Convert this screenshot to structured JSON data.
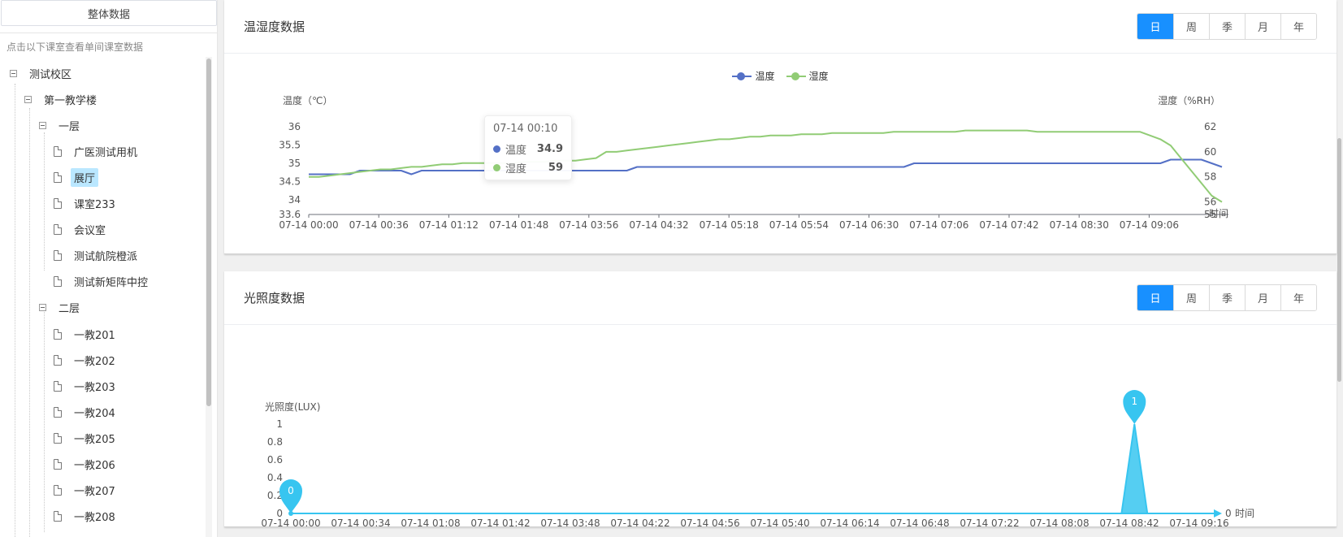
{
  "sidebar": {
    "overall_button": "整体数据",
    "hint": "点击以下课室查看单间课室数据",
    "tree": [
      {
        "label": "测试校区",
        "level": 0,
        "type": "folder"
      },
      {
        "label": "第一教学楼",
        "level": 1,
        "type": "folder"
      },
      {
        "label": "一层",
        "level": 2,
        "type": "folder"
      },
      {
        "label": "广医测试用机",
        "level": 3,
        "type": "leaf"
      },
      {
        "label": "展厅",
        "level": 3,
        "type": "leaf",
        "selected": true
      },
      {
        "label": "课室233",
        "level": 3,
        "type": "leaf"
      },
      {
        "label": "会议室",
        "level": 3,
        "type": "leaf"
      },
      {
        "label": "测试航院橙派",
        "level": 3,
        "type": "leaf"
      },
      {
        "label": "测试新矩阵中控",
        "level": 3,
        "type": "leaf"
      },
      {
        "label": "二层",
        "level": 2,
        "type": "folder"
      },
      {
        "label": "一教201",
        "level": 3,
        "type": "leaf"
      },
      {
        "label": "一教202",
        "level": 3,
        "type": "leaf"
      },
      {
        "label": "一教203",
        "level": 3,
        "type": "leaf"
      },
      {
        "label": "一教204",
        "level": 3,
        "type": "leaf"
      },
      {
        "label": "一教205",
        "level": 3,
        "type": "leaf"
      },
      {
        "label": "一教206",
        "level": 3,
        "type": "leaf"
      },
      {
        "label": "一教207",
        "level": 3,
        "type": "leaf"
      },
      {
        "label": "一教208",
        "level": 3,
        "type": "leaf"
      }
    ]
  },
  "temp_card": {
    "title": "温湿度数据",
    "periods": [
      "日",
      "周",
      "季",
      "月",
      "年"
    ],
    "active_period": "日"
  },
  "light_card": {
    "title": "光照度数据",
    "periods": [
      "日",
      "周",
      "季",
      "月",
      "年"
    ],
    "active_period": "日"
  },
  "tooltip": {
    "time": "07-14 00:10",
    "rows": [
      {
        "name": "温度",
        "value": "34.9",
        "color": "#5470c6"
      },
      {
        "name": "湿度",
        "value": "59",
        "color": "#91cc75"
      }
    ]
  },
  "chart_data": [
    {
      "type": "line",
      "legend": [
        "温度",
        "湿度"
      ],
      "legend_position": "top-center",
      "ylabel_left": "温度（℃）",
      "ylabel_right": "湿度（%RH）",
      "xlabel": "时间",
      "yticks_left": [
        "33.6",
        "34",
        "34.5",
        "35",
        "35.5",
        "36"
      ],
      "yticks_right": [
        "55",
        "56",
        "58",
        "60",
        "62"
      ],
      "ylim_left": [
        33.6,
        36
      ],
      "ylim_right": [
        55,
        62
      ],
      "xticks": [
        "07-14 00:00",
        "07-14 00:36",
        "07-14 01:12",
        "07-14 01:48",
        "07-14 03:56",
        "07-14 04:32",
        "07-14 05:18",
        "07-14 05:54",
        "07-14 06:30",
        "07-14 07:06",
        "07-14 07:42",
        "07-14 08:30",
        "07-14 09:06"
      ],
      "series": [
        {
          "name": "温度",
          "color": "#5470c6",
          "axis": "left",
          "values": [
            34.7,
            34.7,
            34.7,
            34.7,
            34.7,
            34.8,
            34.8,
            34.8,
            34.8,
            34.8,
            34.7,
            34.8,
            34.8,
            34.8,
            34.8,
            34.8,
            34.8,
            34.8,
            34.8,
            34.8,
            34.8,
            34.8,
            34.8,
            34.8,
            34.8,
            34.8,
            34.8,
            34.8,
            34.8,
            34.8,
            34.8,
            34.8,
            34.9,
            34.9,
            34.9,
            34.9,
            34.9,
            34.9,
            34.9,
            34.9,
            34.9,
            34.9,
            34.9,
            34.9,
            34.9,
            34.9,
            34.9,
            34.9,
            34.9,
            34.9,
            34.9,
            34.9,
            34.9,
            34.9,
            34.9,
            34.9,
            34.9,
            34.9,
            34.9,
            35.0,
            35.0,
            35.0,
            35.0,
            35.0,
            35.0,
            35.0,
            35.0,
            35.0,
            35.0,
            35.0,
            35.0,
            35.0,
            35.0,
            35.0,
            35.0,
            35.0,
            35.0,
            35.0,
            35.0,
            35.0,
            35.0,
            35.0,
            35.0,
            35.0,
            35.1,
            35.1,
            35.1,
            35.1,
            35.0,
            34.9
          ]
        },
        {
          "name": "湿度",
          "color": "#91cc75",
          "axis": "right",
          "values": [
            58.0,
            58.0,
            58.1,
            58.2,
            58.3,
            58.4,
            58.5,
            58.6,
            58.6,
            58.7,
            58.8,
            58.8,
            58.9,
            59.0,
            59.0,
            59.1,
            59.1,
            59.1,
            59.1,
            59.1,
            59.1,
            59.2,
            59.2,
            59.2,
            59.3,
            59.3,
            59.3,
            59.4,
            59.5,
            60.0,
            60.0,
            60.1,
            60.2,
            60.3,
            60.4,
            60.5,
            60.6,
            60.7,
            60.8,
            60.9,
            61.0,
            61.0,
            61.1,
            61.2,
            61.2,
            61.3,
            61.3,
            61.3,
            61.4,
            61.4,
            61.4,
            61.5,
            61.5,
            61.5,
            61.5,
            61.5,
            61.5,
            61.6,
            61.6,
            61.6,
            61.6,
            61.6,
            61.6,
            61.6,
            61.7,
            61.7,
            61.7,
            61.7,
            61.7,
            61.7,
            61.7,
            61.6,
            61.6,
            61.6,
            61.6,
            61.6,
            61.6,
            61.6,
            61.6,
            61.6,
            61.6,
            61.6,
            61.3,
            61.0,
            60.5,
            59.5,
            58.5,
            57.5,
            56.5,
            56.0
          ]
        }
      ]
    },
    {
      "type": "area",
      "ylabel": "光照度(LUX)",
      "xlabel": "时间",
      "yticks": [
        "0",
        "0.2",
        "0.4",
        "0.6",
        "0.8",
        "1"
      ],
      "ylim": [
        0,
        1
      ],
      "xticks": [
        "07-14 00:00",
        "07-14 00:34",
        "07-14 01:08",
        "07-14 01:42",
        "07-14 03:48",
        "07-14 04:22",
        "07-14 04:56",
        "07-14 05:40",
        "07-14 06:14",
        "07-14 06:48",
        "07-14 07:22",
        "07-14 08:08",
        "07-14 08:42",
        "07-14 09:16"
      ],
      "series": [
        {
          "name": "光照度",
          "color": "#37c5f0",
          "points": [
            [
              0,
              0
            ],
            [
              0.9,
              0
            ],
            [
              0.914,
              1
            ],
            [
              0.928,
              0
            ],
            [
              1,
              0
            ]
          ]
        }
      ],
      "markers": [
        {
          "label": "0",
          "value": 0,
          "at": 0
        },
        {
          "label": "1",
          "value": 1,
          "at": 0.914
        }
      ],
      "end_label": "0"
    }
  ]
}
